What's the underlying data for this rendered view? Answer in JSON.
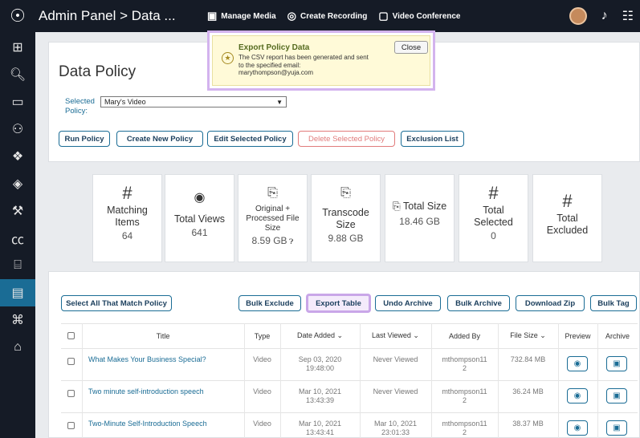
{
  "header": {
    "title": "Admin Panel > Data ...",
    "actions": [
      {
        "label": "Manage Media",
        "icon": "media-icon"
      },
      {
        "label": "Create Recording",
        "icon": "recording-icon"
      },
      {
        "label": "Video Conference",
        "icon": "conference-icon"
      }
    ]
  },
  "sidebar": {
    "items": [
      {
        "icon": "dashboard-icon"
      },
      {
        "icon": "search-icon"
      },
      {
        "icon": "monitor-icon"
      },
      {
        "icon": "users-icon"
      },
      {
        "icon": "integrations-icon"
      },
      {
        "icon": "layers-icon"
      },
      {
        "icon": "tools-icon"
      },
      {
        "icon": "captions-icon"
      },
      {
        "icon": "drive-icon"
      },
      {
        "icon": "data-icon",
        "active": true
      },
      {
        "icon": "devices-icon"
      },
      {
        "icon": "building-icon"
      }
    ]
  },
  "page": {
    "title": "Data Policy",
    "selected_label": "Selected Policy:",
    "selected_value": "Mary's Video",
    "buttons": {
      "run": "Run Policy",
      "create": "Create New Policy",
      "edit": "Edit Selected Policy",
      "delete": "Delete Selected Policy",
      "exclusion": "Exclusion List"
    }
  },
  "notification": {
    "title": "Export Policy Data",
    "message": "The CSV report has been generated and sent to the specified email:",
    "email": "marythompson@yuja.com",
    "close": "Close"
  },
  "stats": [
    {
      "symbol": "#",
      "label": "Matching Items",
      "value": "64"
    },
    {
      "symbol": "◉",
      "label": "Total Views",
      "value": "641"
    },
    {
      "symbol": "⎘",
      "label": "Original + Processed File Size",
      "value": "8.59 GB"
    },
    {
      "symbol": "⎘",
      "label": "Transcode Size",
      "value": "9.88 GB"
    },
    {
      "symbol": "⎘",
      "label": "Total Size",
      "value": "18.46 GB"
    },
    {
      "symbol": "#",
      "label": "Total Selected",
      "value": "0"
    },
    {
      "symbol": "#",
      "label": "Total Excluded",
      "value": ""
    }
  ],
  "table_actions": {
    "select_all": "Select All That Match Policy",
    "bulk_exclude": "Bulk Exclude",
    "export": "Export Table",
    "undo_archive": "Undo Archive",
    "bulk_archive": "Bulk Archive",
    "download_zip": "Download Zip",
    "bulk_tag": "Bulk Tag"
  },
  "table": {
    "headers": [
      "Title",
      "Type",
      "Date Added ⌄",
      "Last Viewed ⌄",
      "Added By",
      "File Size ⌄",
      "Preview",
      "Archive"
    ],
    "rows": [
      {
        "title": "What Makes Your Business Special?",
        "type": "Video",
        "date": "Sep 03, 2020\n19:48:00",
        "viewed": "Never Viewed",
        "by": "mthompson11\n2",
        "size": "732.84 MB"
      },
      {
        "title": "Two minute self-introduction speech",
        "type": "Video",
        "date": "Mar 10, 2021\n13:43:39",
        "viewed": "Never Viewed",
        "by": "mthompson11\n2",
        "size": "36.24 MB"
      },
      {
        "title": "Two-Minute Self-Introduction Speech",
        "type": "Video",
        "date": "Mar 10, 2021\n13:43:41",
        "viewed": "Mar 10, 2021\n23:01:33",
        "by": "mthompson11\n2",
        "size": "38.37 MB"
      }
    ]
  }
}
